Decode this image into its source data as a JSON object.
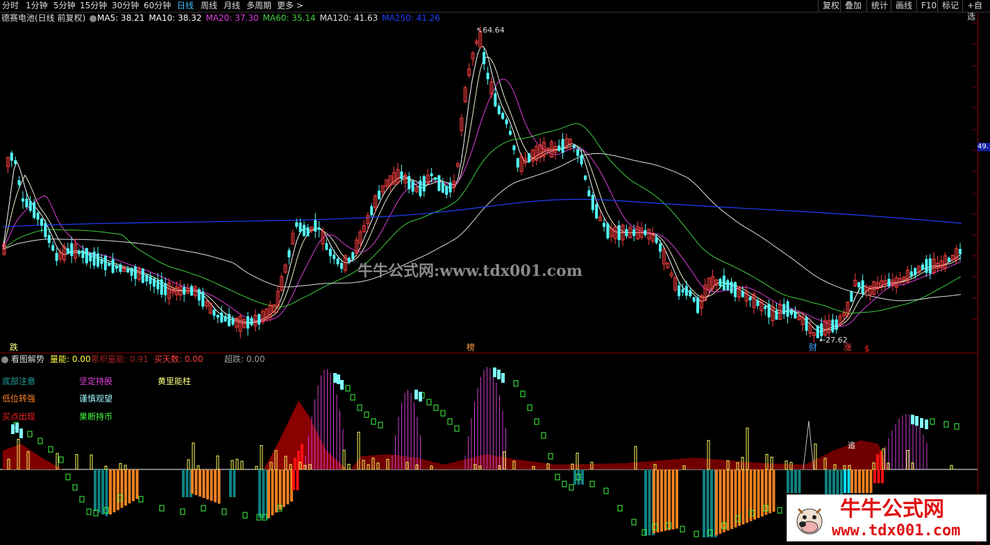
{
  "toolbar": {
    "periods": [
      "分时",
      "1分钟",
      "5分钟",
      "15分钟",
      "30分钟",
      "60分钟",
      "日线",
      "周线",
      "月线",
      "多周期",
      "更多 >"
    ],
    "active_period": "日线",
    "right_buttons": [
      "复权",
      "叠加",
      "统计",
      "画线",
      "F10",
      "标记",
      "+自选"
    ]
  },
  "main_panel": {
    "stock_title": "德赛电池(日线 前复权)",
    "ma": [
      {
        "label": "MA5:",
        "value": "38.21",
        "color": "#ffffff"
      },
      {
        "label": "MA10:",
        "value": "38.32",
        "color": "#ffffff"
      },
      {
        "label": "MA20:",
        "value": "37.30",
        "color": "#e040e0"
      },
      {
        "label": "MA60:",
        "value": "35.14",
        "color": "#40d040"
      },
      {
        "label": "MA120:",
        "value": "41.63",
        "color": "#e0e0e0"
      },
      {
        "label": "MA250:",
        "value": "41.26",
        "color": "#2040ff"
      }
    ],
    "high_label": "64.64",
    "low_label": "27.62",
    "markers": [
      "跌",
      "榜",
      "财",
      "涨",
      "$"
    ],
    "price_badge": "49.",
    "watermark": "牛牛公式网:www.tdx001.com",
    "colors": {
      "up": "#ff4040",
      "down": "#54ffff",
      "ma5": "#ffffff",
      "ma20": "#e040e0",
      "ma60": "#40d040",
      "ma120": "#e0e0e0",
      "ma250": "#2040ff"
    }
  },
  "indicator_panel": {
    "title": "看图解势",
    "metrics": [
      {
        "label": "量能:",
        "value": "0.00",
        "color": "#ffff40"
      },
      {
        "label": "累积量能:",
        "value": "0.91",
        "color": "#a02020"
      },
      {
        "label": "买天数:",
        "value": "0.00",
        "color": "#ff4040"
      },
      {
        "label": "超跌:",
        "value": "0.00",
        "color": "#a0a0a0"
      }
    ],
    "legend": [
      {
        "text": "底部注意",
        "color": "#20a0a0"
      },
      {
        "text": "坚定持股",
        "color": "#e040e0"
      },
      {
        "text": "黄里能柱",
        "color": "#ffff80"
      },
      {
        "text": "低位转强",
        "color": "#ff8020"
      },
      {
        "text": "谨慎观望",
        "color": "#a0ffff"
      },
      {
        "text": "买点出现",
        "color": "#ff2020"
      },
      {
        "text": "果断持币",
        "color": "#40ff40"
      }
    ],
    "marker": "追"
  },
  "logo": {
    "cn": "牛牛公式网",
    "url": "www.tdx001.com"
  }
}
